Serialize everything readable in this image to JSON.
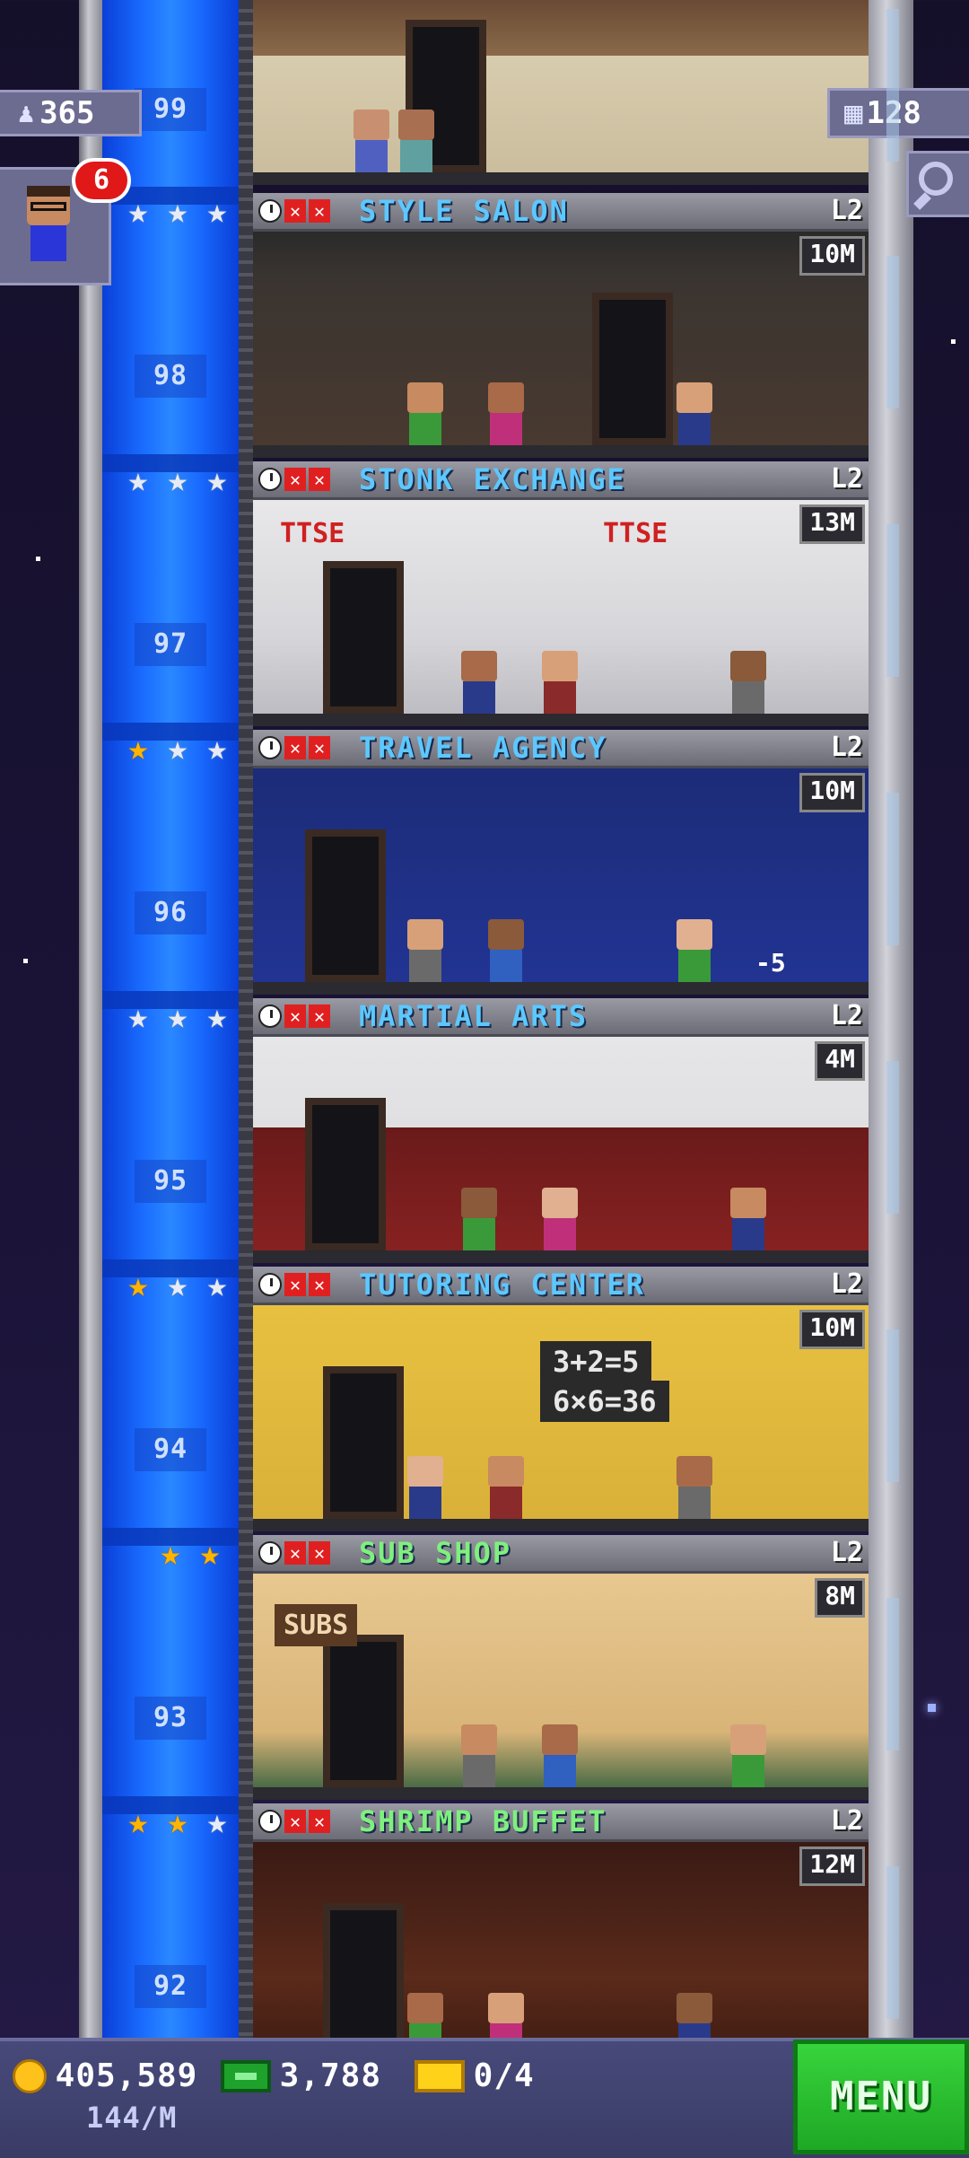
{
  "hud": {
    "population": "365",
    "floors_count": "128",
    "notification_count": "6"
  },
  "floor_numbers": [
    "99",
    "98",
    "97",
    "96",
    "95",
    "94",
    "93",
    "92"
  ],
  "floors": [
    {
      "name": "STYLE SALON",
      "level": "L2",
      "price": "10M",
      "stars": [
        "silver",
        "silver",
        "silver"
      ],
      "name_color": "blue"
    },
    {
      "name": "STONK EXCHANGE",
      "level": "L2",
      "price": "13M",
      "stars": [
        "silver",
        "silver",
        "silver"
      ],
      "name_color": "blue"
    },
    {
      "name": "TRAVEL AGENCY",
      "level": "L2",
      "price": "10M",
      "stars": [
        "gold",
        "silver",
        "silver"
      ],
      "name_color": "blue"
    },
    {
      "name": "MARTIAL ARTS",
      "level": "L2",
      "price": "4M",
      "stars": [
        "silver",
        "silver",
        "silver"
      ],
      "name_color": "blue"
    },
    {
      "name": "TUTORING CENTER",
      "level": "L2",
      "price": "10M",
      "stars": [
        "gold",
        "silver",
        "silver"
      ],
      "name_color": "blue"
    },
    {
      "name": "SUB SHOP",
      "level": "L2",
      "price": "8M",
      "stars": [
        "gold",
        "gold"
      ],
      "name_color": "green"
    },
    {
      "name": "SHRIMP BUFFET",
      "level": "L2",
      "price": "12M",
      "stars": [
        "gold",
        "gold",
        "silver"
      ],
      "name_color": "green"
    }
  ],
  "room_text": {
    "stonk_sign": "TTSE",
    "math_line1": "3+2=5",
    "math_line2": "6×6=36",
    "subs_sign": "SUBS",
    "travel_tag": "-5"
  },
  "bottom_bar": {
    "coins": "405,589",
    "coin_rate": "144/M",
    "bux": "3,788",
    "tickets": "0/4",
    "menu_label": "MENU"
  },
  "colors": {
    "elevator": "#1a6cff",
    "name_blue": "#5cc8ff",
    "name_green": "#7ef07e",
    "menu_green": "#2ec236",
    "star_gold": "#ffb400"
  }
}
